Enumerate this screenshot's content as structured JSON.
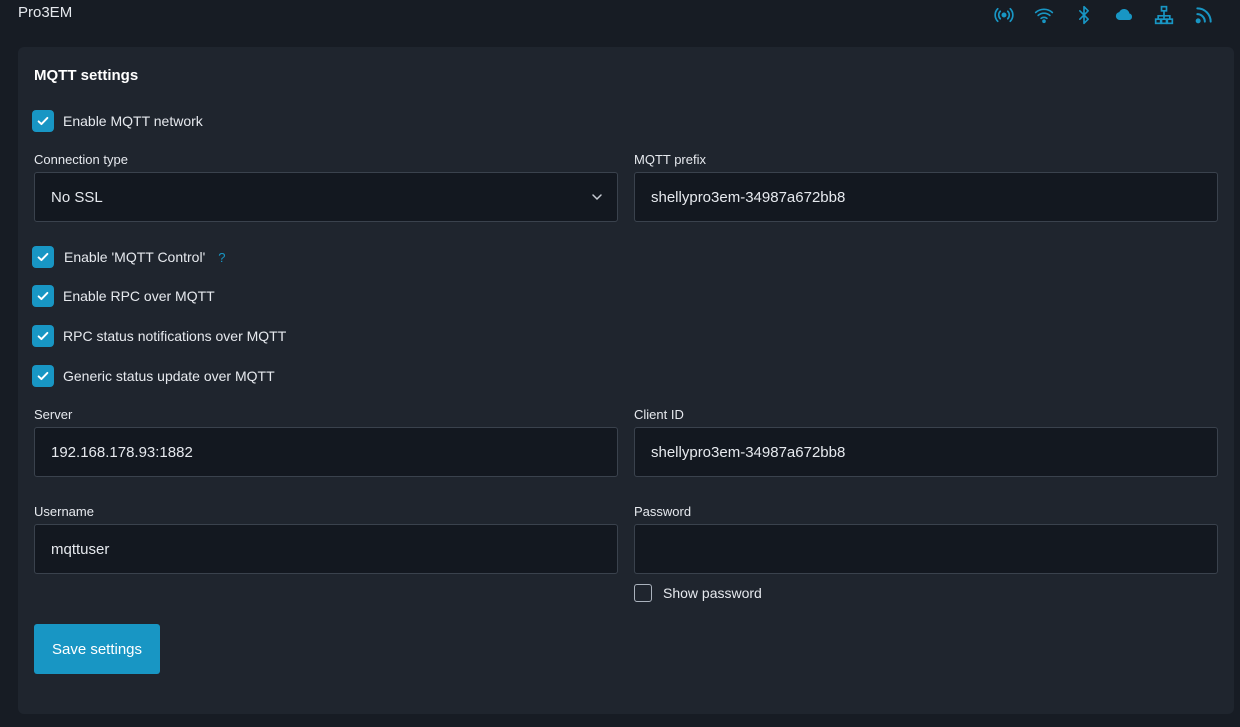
{
  "header": {
    "device_name": "Pro3EM",
    "icons": [
      "radio-signal-icon",
      "wifi-icon",
      "bluetooth-icon",
      "cloud-icon",
      "ethernet-icon",
      "rss-icon"
    ],
    "icon_color": "#1896c4"
  },
  "mqtt": {
    "title": "MQTT settings",
    "enable_network": {
      "label": "Enable MQTT network",
      "checked": true
    },
    "connection_type": {
      "label": "Connection type",
      "value": "No SSL"
    },
    "prefix": {
      "label": "MQTT prefix",
      "value": "shellypro3em-34987a672bb8"
    },
    "enable_control": {
      "label": "Enable 'MQTT Control'",
      "help": "?",
      "checked": true
    },
    "enable_rpc": {
      "label": "Enable RPC over MQTT",
      "checked": true
    },
    "rpc_status": {
      "label": "RPC status notifications over MQTT",
      "checked": true
    },
    "generic_status": {
      "label": "Generic status update over MQTT",
      "checked": true
    },
    "server": {
      "label": "Server",
      "value": "192.168.178.93:1882"
    },
    "client_id": {
      "label": "Client ID",
      "value": "shellypro3em-34987a672bb8"
    },
    "username": {
      "label": "Username",
      "value": "mqttuser"
    },
    "password": {
      "label": "Password",
      "value": ""
    },
    "show_password": {
      "label": "Show password",
      "checked": false
    },
    "save_label": "Save settings"
  },
  "colors": {
    "accent": "#1896c4",
    "panel": "#1f252e",
    "background": "#171c24"
  }
}
